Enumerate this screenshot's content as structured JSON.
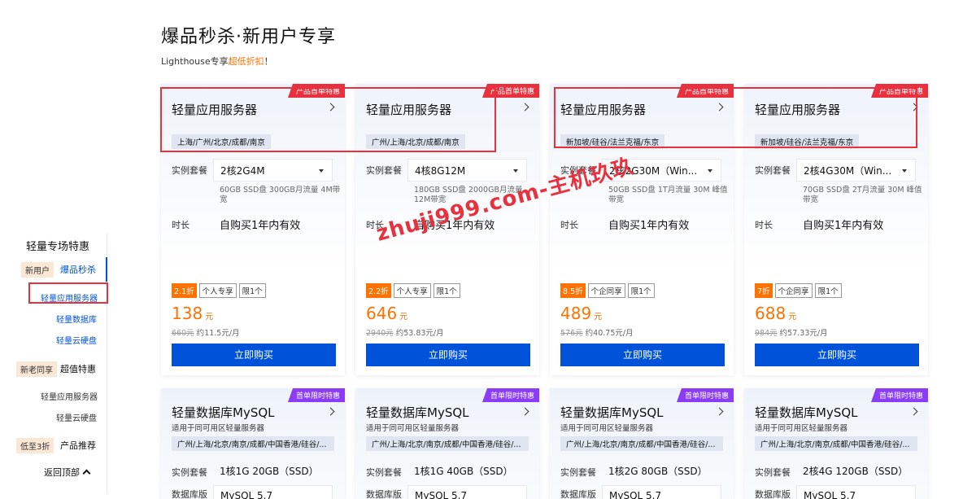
{
  "header": {
    "title": "爆品秒杀·新用户专享",
    "subtitle_prefix": "Lighthouse专享",
    "subtitle_highlight": "超低折扣",
    "subtitle_suffix": "！"
  },
  "sidebar": {
    "title": "轻量专场特惠",
    "groups": [
      {
        "tag": "新用户",
        "label": "爆品秒杀",
        "items": [
          "轻量应用服务器",
          "轻量数据库",
          "轻量云硬盘"
        ]
      },
      {
        "tag": "新老同享",
        "label": "超值特惠",
        "items": [
          "轻量应用服务器",
          "轻量云硬盘"
        ]
      },
      {
        "tag": "低至3折",
        "label": "产品推荐",
        "items": []
      }
    ],
    "back_to_top": "返回顶部"
  },
  "labels": {
    "package": "实例套餐",
    "duration": "时长",
    "db_version": "数据库版",
    "buy": "立即购买"
  },
  "cards_row1": [
    {
      "badge": "产品首单特惠",
      "title": "轻量应用服务器",
      "region": "上海/广州/北京/成都/南京",
      "package": "2核2G4M",
      "spec": "60GB SSD盘 300GB月流量 4M带宽",
      "duration": "自购买1年内有效",
      "discount": "2.1折",
      "tags": [
        "个人专享",
        "限1个"
      ],
      "price": "138",
      "unit": "元",
      "original": "660元",
      "monthly": "约11.5元/月"
    },
    {
      "badge": "产品首单特惠",
      "title": "轻量应用服务器",
      "region": "广州/上海/北京/成都/南京",
      "package": "4核8G12M",
      "spec": "180GB SSD盘 2000GB月流量 12M带宽",
      "duration": "自购买1年内有效",
      "discount": "2.2折",
      "tags": [
        "个人专享",
        "限1个"
      ],
      "price": "646",
      "unit": "元",
      "original": "2940元",
      "monthly": "约53.83元/月"
    },
    {
      "badge": "产品首单特惠",
      "title": "轻量应用服务器",
      "region": "新加坡/硅谷/法兰克福/东京",
      "package": "2核2G30M（Win...",
      "spec": "50GB SSD盘 1T月流量 30M 峰值带宽",
      "duration": "自购买1年内有效",
      "discount": "8.5折",
      "tags": [
        "个企同享",
        "限1个"
      ],
      "price": "489",
      "unit": "元",
      "original": "576元",
      "monthly": "约40.75元/月"
    },
    {
      "badge": "产品首单特惠",
      "title": "轻量应用服务器",
      "region": "新加坡/硅谷/法兰克福/东京",
      "package": "2核4G30M（Win...",
      "spec": "70GB SSD盘 2T月流量 30M 峰值带宽",
      "duration": "自购买1年内有效",
      "discount": "7折",
      "tags": [
        "个企同享",
        "限1个"
      ],
      "price": "688",
      "unit": "元",
      "original": "984元",
      "monthly": "约57.33元/月"
    }
  ],
  "cards_row2": [
    {
      "badge": "首单限时特惠",
      "title": "轻量数据库MySQL",
      "desc": "适用于同可用区轻量服务器",
      "region": "广州/上海/北京/南京/成都/中国香港/硅谷/...",
      "package": "1核1G 20GB（SSD）",
      "version": "MySQL 5.7"
    },
    {
      "badge": "首单限时特惠",
      "title": "轻量数据库MySQL",
      "desc": "适用于同可用区轻量服务器",
      "region": "广州/上海/北京/南京/成都/中国香港/硅谷/...",
      "package": "1核1G 40GB（SSD）",
      "version": "MySQL 5.7"
    },
    {
      "badge": "首单限时特惠",
      "title": "轻量数据库MySQL",
      "desc": "适用于同可用区轻量服务器",
      "region": "广州/上海/北京/南京/成都/中国香港/硅谷/...",
      "package": "1核2G 80GB（SSD）",
      "version": "MySQL 5.7"
    },
    {
      "badge": "首单限时特惠",
      "title": "轻量数据库MySQL",
      "desc": "适用于同可用区轻量服务器",
      "region": "广州/上海/北京/南京/成都/中国香港/硅谷/...",
      "package": "2核4G 120GB（SSD）",
      "version": "MySQL 5.7"
    }
  ],
  "watermark": "zhuji999.com-主机玖玖",
  "colors": {
    "primary": "#0052d9",
    "accent": "#ff7200",
    "badge_red": "#e8313f",
    "badge_purple": "#8a3cf6"
  }
}
